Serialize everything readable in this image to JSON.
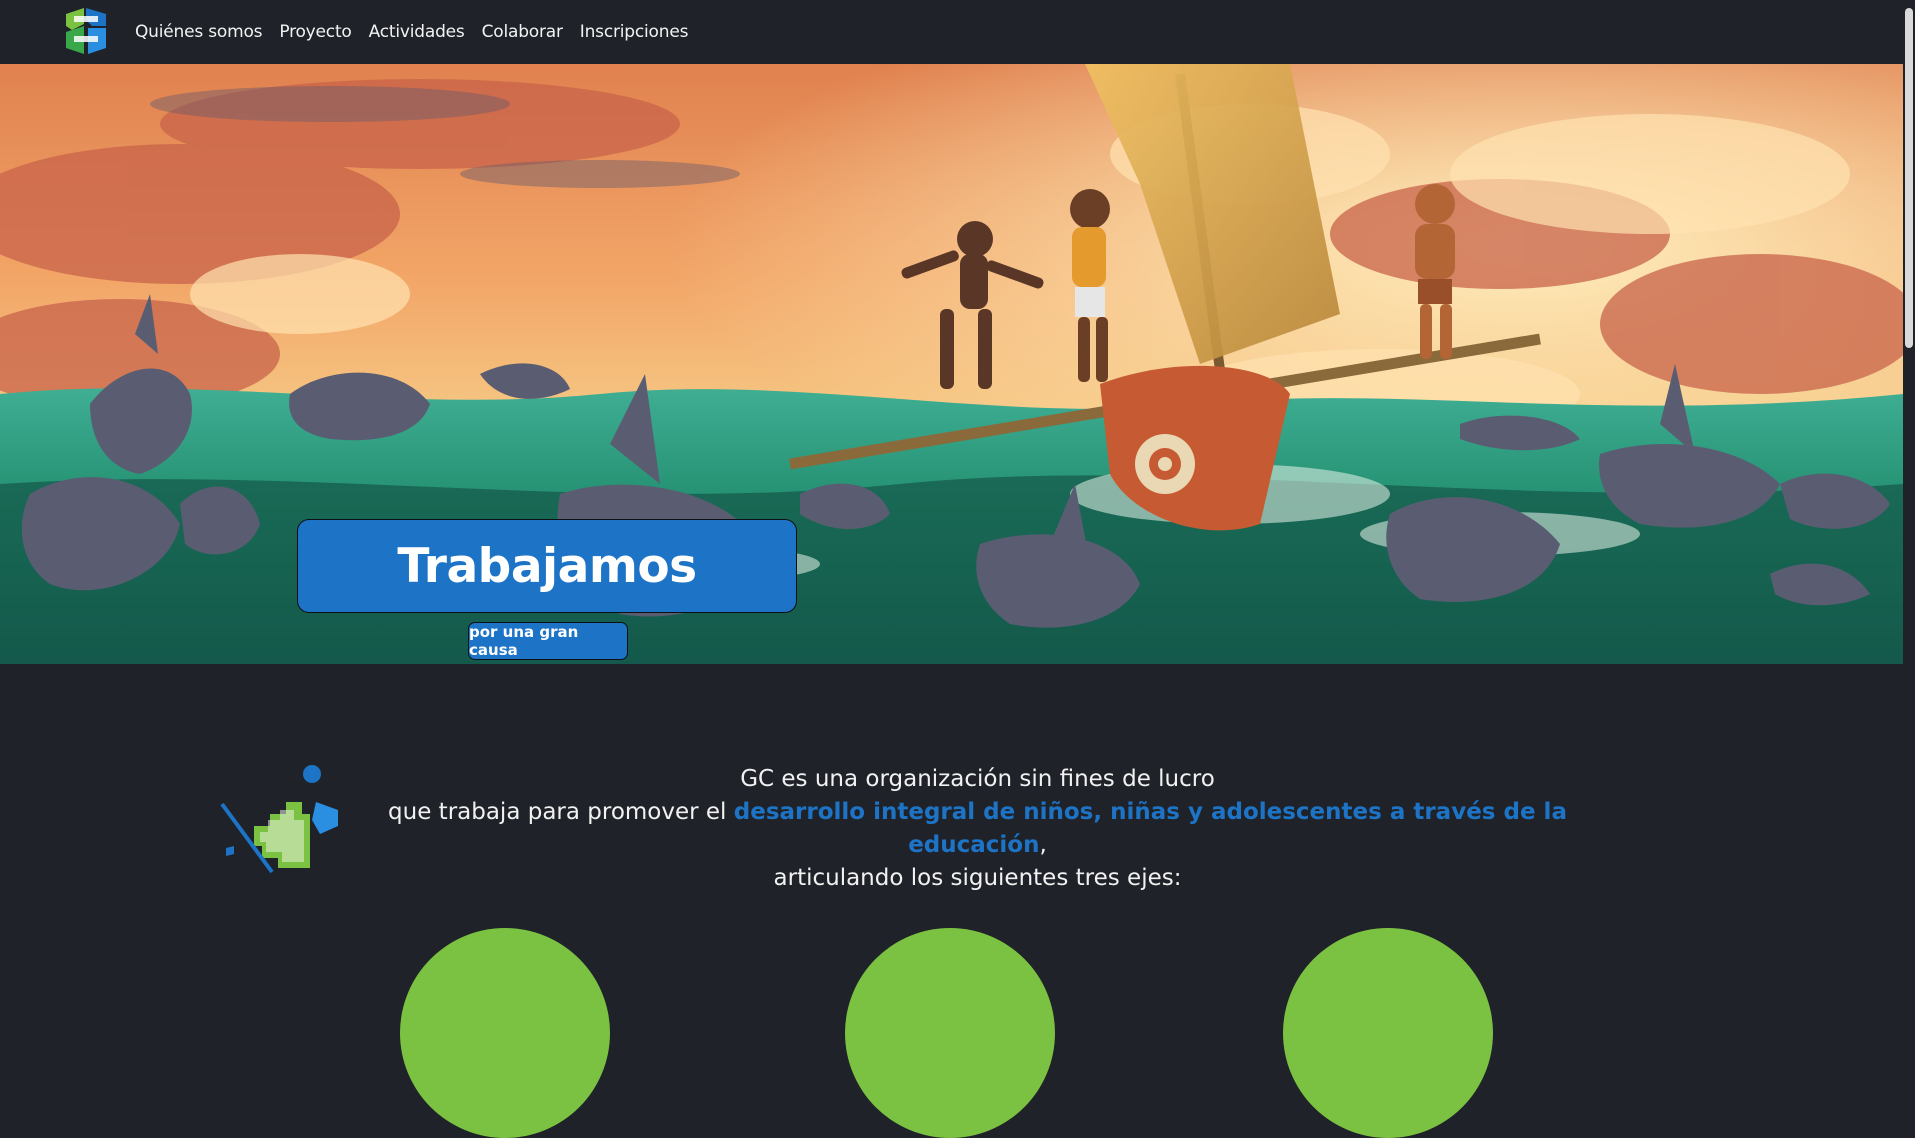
{
  "nav": {
    "logo_alt": "GC",
    "links": [
      "Quiénes somos",
      "Proyecto",
      "Actividades",
      "Colaborar",
      "Inscripciones"
    ]
  },
  "hero": {
    "title": "Trabajamos",
    "subtitle_button": "por una gran causa"
  },
  "intro": {
    "line1": "GC es una organización sin fines de lucro",
    "line2_pre": "que trabaja para promover el ",
    "line2_highlight": "desarrollo integral de niños, niñas y adolescentes a través de la educación",
    "line2_post": ",",
    "line3": "articulando los siguientes tres ejes:"
  },
  "colors": {
    "accent": "#1d74c6",
    "background": "#1f2329",
    "green": "#7cc242"
  },
  "icons": [
    "logo-icon",
    "stairs-figure-icon"
  ]
}
